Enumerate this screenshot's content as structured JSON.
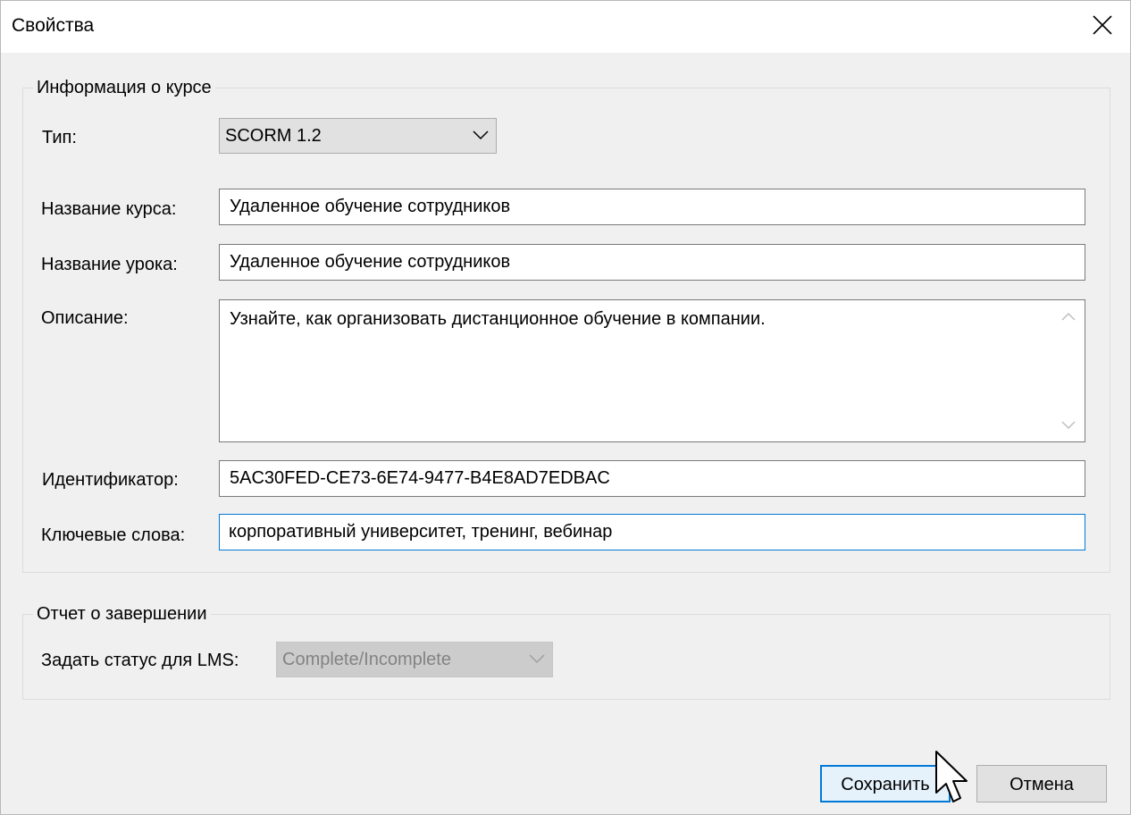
{
  "window": {
    "title": "Свойства"
  },
  "course_info": {
    "legend": "Информация о курсе",
    "type_label": "Тип:",
    "type_value": "SCORM 1.2",
    "course_name_label": "Название курса:",
    "course_name_value": "Удаленное обучение сотрудников",
    "lesson_name_label": "Название урока:",
    "lesson_name_value": "Удаленное обучение сотрудников",
    "description_label": "Описание:",
    "description_value": "Узнайте, как организовать дистанционное обучение в компании.",
    "identifier_label": "Идентификатор:",
    "identifier_value": "5AC30FED-CE73-6E74-9477-B4E8AD7EDBAC",
    "keywords_label": "Ключевые слова:",
    "keywords_value": "корпоративный университет, тренинг, вебинар"
  },
  "completion_report": {
    "legend": "Отчет о завершении",
    "lms_status_label": "Задать статус для LMS:",
    "lms_status_value": "Complete/Incomplete",
    "lms_status_disabled": true
  },
  "buttons": {
    "save_label": "Сохранить",
    "cancel_label": "Отмена"
  },
  "icons": {
    "close": "close-icon",
    "dropdown": "chevron-down-icon",
    "scroll_up": "chevron-up-icon",
    "scroll_down": "chevron-down-icon",
    "cursor": "mouse-pointer-icon"
  },
  "colors": {
    "accent": "#0078d7",
    "window_bg": "#f0f0f0",
    "titlebar_bg": "#ffffff"
  }
}
